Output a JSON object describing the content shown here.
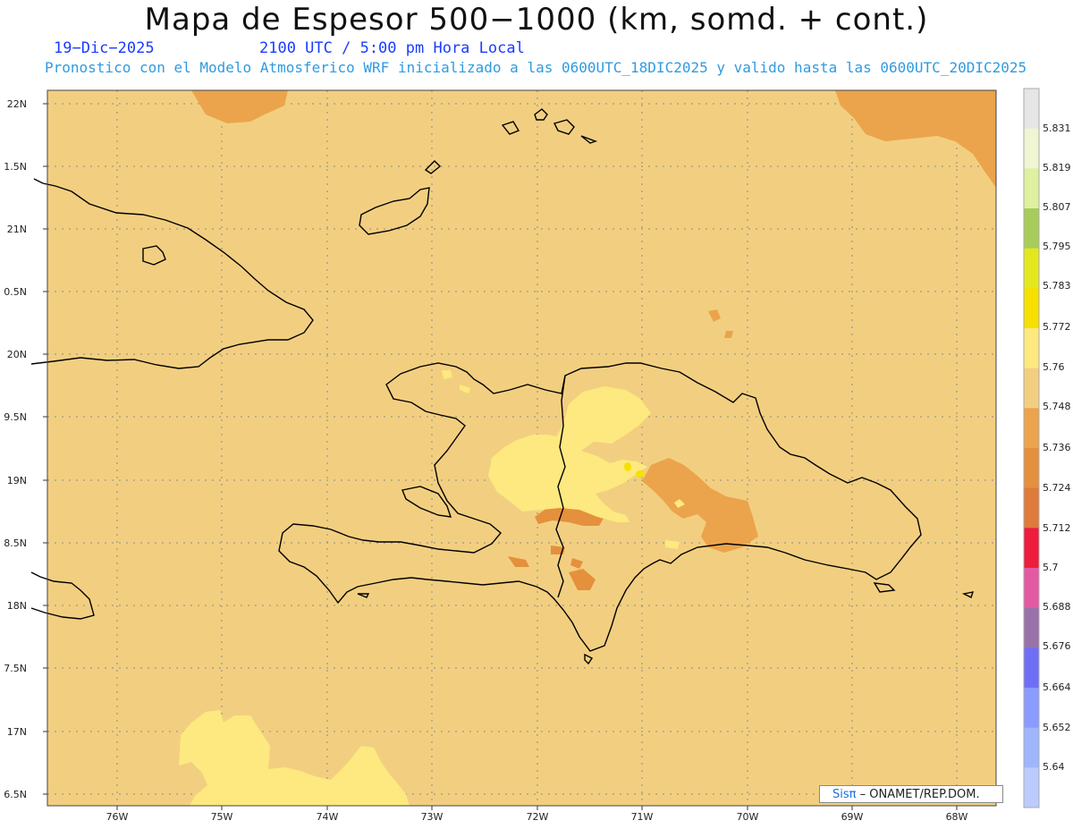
{
  "header": {
    "title": "Mapa de Espesor 500−1000 (km, somd. + cont.)",
    "date": "19−Dic−2025",
    "time": "2100 UTC / 5:00 pm Hora Local",
    "model_line": "Pronostico con el Modelo Atmosferico WRF inicializado a las 0600UTC_18DIC2025 y valido hasta las  0600UTC_20DIC2025"
  },
  "axes": {
    "lat_labels": [
      "22N",
      "1.5N",
      "21N",
      "0.5N",
      "20N",
      "9.5N",
      "19N",
      "8.5N",
      "18N",
      "7.5N",
      "17N",
      "6.5N"
    ],
    "lon_labels": [
      "76W",
      "75W",
      "74W",
      "73W",
      "72W",
      "71W",
      "70W",
      "69W",
      "68W"
    ]
  },
  "colorbar": {
    "levels": [
      "5.831",
      "5.819",
      "5.807",
      "5.795",
      "5.783",
      "5.772",
      "5.76",
      "5.748",
      "5.736",
      "5.724",
      "5.712",
      "5.7",
      "5.688",
      "5.676",
      "5.664",
      "5.652",
      "5.64"
    ],
    "colors": [
      "#e6e6e6",
      "#f0f5d2",
      "#dff0a0",
      "#a8cc5a",
      "#e3e81e",
      "#f7e000",
      "#fde97f",
      "#f2cf80",
      "#eba44c",
      "#e5903d",
      "#df7a3a",
      "#ee1c3d",
      "#e45aa2",
      "#9a72aa",
      "#6f6ff5",
      "#8a9cff",
      "#9fb6ff",
      "#bccbff"
    ]
  },
  "credit": {
    "brand": "Sisπ",
    "text": "– ONAMET/REP.DOM."
  }
}
